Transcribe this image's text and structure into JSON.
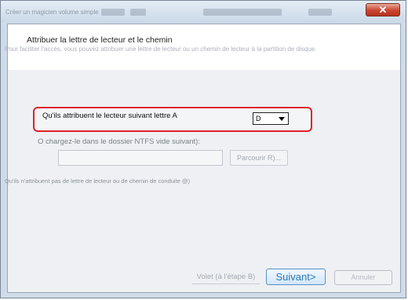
{
  "window": {
    "title": "Créer un magicien volume simple",
    "close_symbol": "✕"
  },
  "header": {
    "title": "Attribuer la lettre de lecteur et le chemin",
    "description": "Pour faciliter l'accès, vous pouvez attribuer une lettre de lecteur ou un chemin de lecteur à la partition de disque."
  },
  "options": {
    "assign_letter_label": "Qu'ils attribuent le lecteur suivant lettre A",
    "drive_letter_value": "D",
    "mount_folder_label": "O chargez-le dans le dossier NTFS vide suivant):",
    "folder_path_value": "",
    "browse_label": "Parcourir R)...",
    "no_assign_label": "Qu'ils n'attribuent pas de lettre de lecteur ou de chemin de conduite @)"
  },
  "footer": {
    "back_label": "Volet (à l'étape B)",
    "next_label": "Suivant>",
    "finish_label": "Annuler"
  },
  "colors": {
    "highlight_border": "#e0202a",
    "next_button_text": "#2a7ab8"
  }
}
